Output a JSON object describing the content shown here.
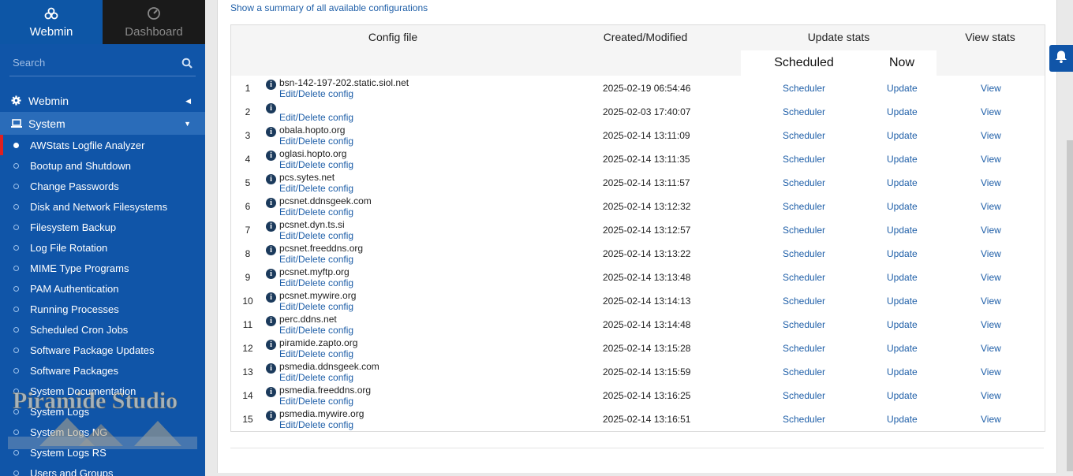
{
  "sidebar": {
    "tabs": [
      {
        "label": "Webmin",
        "icon": "webmin-logo-icon"
      },
      {
        "label": "Dashboard",
        "icon": "dashboard-icon"
      }
    ],
    "search_placeholder": "Search",
    "categories": [
      {
        "label": "Webmin",
        "icon": "gear-icon"
      },
      {
        "label": "System",
        "icon": "laptop-icon"
      }
    ],
    "items": [
      "AWStats Logfile Analyzer",
      "Bootup and Shutdown",
      "Change Passwords",
      "Disk and Network Filesystems",
      "Filesystem Backup",
      "Log File Rotation",
      "MIME Type Programs",
      "PAM Authentication",
      "Running Processes",
      "Scheduled Cron Jobs",
      "Software Package Updates",
      "Software Packages",
      "System Documentation",
      "System Logs",
      "System Logs NG",
      "System Logs RS",
      "Users and Groups"
    ],
    "watermark": "Piramide Studio"
  },
  "main": {
    "summary_link": "Show a summary of all available configurations",
    "headers": {
      "config_file": "Config file",
      "created": "Created/Modified",
      "update_stats": "Update stats",
      "view_stats": "View stats",
      "scheduled": "Scheduled",
      "now": "Now"
    },
    "edit_label": "Edit/Delete config",
    "scheduler_label": "Scheduler",
    "update_label": "Update",
    "view_label": "View",
    "rows": [
      {
        "num": "1",
        "name": "bsn-142-197-202.static.siol.net",
        "date": "2025-02-19 06:54:46"
      },
      {
        "num": "2",
        "name": "",
        "date": "2025-02-03 17:40:07"
      },
      {
        "num": "3",
        "name": "obala.hopto.org",
        "date": "2025-02-14 13:11:09"
      },
      {
        "num": "4",
        "name": "oglasi.hopto.org",
        "date": "2025-02-14 13:11:35"
      },
      {
        "num": "5",
        "name": "pcs.sytes.net",
        "date": "2025-02-14 13:11:57"
      },
      {
        "num": "6",
        "name": "pcsnet.ddnsgeek.com",
        "date": "2025-02-14 13:12:32"
      },
      {
        "num": "7",
        "name": "pcsnet.dyn.ts.si",
        "date": "2025-02-14 13:12:57"
      },
      {
        "num": "8",
        "name": "pcsnet.freeddns.org",
        "date": "2025-02-14 13:13:22"
      },
      {
        "num": "9",
        "name": "pcsnet.myftp.org",
        "date": "2025-02-14 13:13:48"
      },
      {
        "num": "10",
        "name": "pcsnet.mywire.org",
        "date": "2025-02-14 13:14:13"
      },
      {
        "num": "11",
        "name": "perc.ddns.net",
        "date": "2025-02-14 13:14:48"
      },
      {
        "num": "12",
        "name": "piramide.zapto.org",
        "date": "2025-02-14 13:15:28"
      },
      {
        "num": "13",
        "name": "psmedia.ddnsgeek.com",
        "date": "2025-02-14 13:15:59"
      },
      {
        "num": "14",
        "name": "psmedia.freeddns.org",
        "date": "2025-02-14 13:16:25"
      },
      {
        "num": "15",
        "name": "psmedia.mywire.org",
        "date": "2025-02-14 13:16:51"
      }
    ]
  },
  "colors": {
    "sidebar_bg": "#1055a8",
    "link": "#1f5fa8",
    "active_marker": "#e02020"
  }
}
